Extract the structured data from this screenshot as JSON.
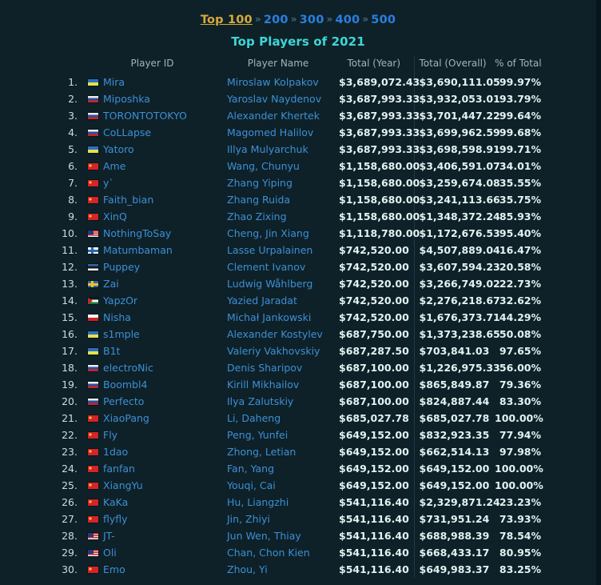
{
  "nav": {
    "items": [
      {
        "label": "Top 100",
        "current": true
      },
      {
        "label": "200",
        "current": false
      },
      {
        "label": "300",
        "current": false
      },
      {
        "label": "400",
        "current": false
      },
      {
        "label": "500",
        "current": false
      }
    ],
    "separator": "»"
  },
  "page_title": "Top Players of 2021",
  "colors": {
    "background": "#0e2128",
    "title": "#3fd6d6",
    "link": "#3d8fd6",
    "current_nav": "#d9a93a",
    "value_text": "#e3f2f3",
    "header_text": "#9fb5bb"
  },
  "table": {
    "headers": {
      "rank": "",
      "player_id": "Player ID",
      "player_name": "Player Name",
      "total_year": "Total (Year)",
      "total_overall": "Total (Overall)",
      "pct_of_total": "% of Total"
    },
    "rows": [
      {
        "rank": "1.",
        "flag": "ua",
        "player_id": "Mira",
        "player_name": "Miroslaw Kolpakov",
        "total_year": "$3,689,072.43",
        "total_overall": "$3,690,111.05",
        "pct": "99.97%"
      },
      {
        "rank": "2.",
        "flag": "ru",
        "player_id": "Miposhka",
        "player_name": "Yaroslav Naydenov",
        "total_year": "$3,687,993.33",
        "total_overall": "$3,932,053.01",
        "pct": "93.79%"
      },
      {
        "rank": "3.",
        "flag": "ru",
        "player_id": "TORONTOTOKYO",
        "player_name": "Alexander Khertek",
        "total_year": "$3,687,993.33",
        "total_overall": "$3,701,447.22",
        "pct": "99.64%"
      },
      {
        "rank": "4.",
        "flag": "ru",
        "player_id": "CoLLapse",
        "player_name": "Magomed Halilov",
        "total_year": "$3,687,993.33",
        "total_overall": "$3,699,962.59",
        "pct": "99.68%"
      },
      {
        "rank": "5.",
        "flag": "ua",
        "player_id": "Yatoro",
        "player_name": "Illya Mulyarchuk",
        "total_year": "$3,687,993.33",
        "total_overall": "$3,698,598.91",
        "pct": "99.71%"
      },
      {
        "rank": "6.",
        "flag": "cn",
        "player_id": "Ame",
        "player_name": "Wang, Chunyu",
        "total_year": "$1,158,680.00",
        "total_overall": "$3,406,591.07",
        "pct": "34.01%"
      },
      {
        "rank": "7.",
        "flag": "cn",
        "player_id": "y`",
        "player_name": "Zhang Yiping",
        "total_year": "$1,158,680.00",
        "total_overall": "$3,259,674.08",
        "pct": "35.55%"
      },
      {
        "rank": "8.",
        "flag": "cn",
        "player_id": "Faith_bian",
        "player_name": "Zhang Ruida",
        "total_year": "$1,158,680.00",
        "total_overall": "$3,241,113.66",
        "pct": "35.75%"
      },
      {
        "rank": "9.",
        "flag": "cn",
        "player_id": "XinQ",
        "player_name": "Zhao Zixing",
        "total_year": "$1,158,680.00",
        "total_overall": "$1,348,372.24",
        "pct": "85.93%"
      },
      {
        "rank": "10.",
        "flag": "my",
        "player_id": "NothingToSay",
        "player_name": "Cheng, Jin Xiang",
        "total_year": "$1,118,780.00",
        "total_overall": "$1,172,676.53",
        "pct": "95.40%"
      },
      {
        "rank": "11.",
        "flag": "fi",
        "player_id": "Matumbaman",
        "player_name": "Lasse Urpalainen",
        "total_year": "$742,520.00",
        "total_overall": "$4,507,889.04",
        "pct": "16.47%"
      },
      {
        "rank": "12.",
        "flag": "ee",
        "player_id": "Puppey",
        "player_name": "Clement Ivanov",
        "total_year": "$742,520.00",
        "total_overall": "$3,607,594.23",
        "pct": "20.58%"
      },
      {
        "rank": "13.",
        "flag": "se",
        "player_id": "Zai",
        "player_name": "Ludwig Wåhlberg",
        "total_year": "$742,520.00",
        "total_overall": "$3,266,749.02",
        "pct": "22.73%"
      },
      {
        "rank": "14.",
        "flag": "jo",
        "player_id": "YapzOr",
        "player_name": "Yazied Jaradat",
        "total_year": "$742,520.00",
        "total_overall": "$2,276,218.67",
        "pct": "32.62%"
      },
      {
        "rank": "15.",
        "flag": "pl",
        "player_id": "Nisha",
        "player_name": "Michał Jankowski",
        "total_year": "$742,520.00",
        "total_overall": "$1,676,373.71",
        "pct": "44.29%"
      },
      {
        "rank": "16.",
        "flag": "ua",
        "player_id": "s1mple",
        "player_name": "Alexander Kostylev",
        "total_year": "$687,750.00",
        "total_overall": "$1,373,238.65",
        "pct": "50.08%"
      },
      {
        "rank": "17.",
        "flag": "ua",
        "player_id": "B1t",
        "player_name": "Valeriy Vakhovskiy",
        "total_year": "$687,287.50",
        "total_overall": "$703,841.03",
        "pct": "97.65%"
      },
      {
        "rank": "18.",
        "flag": "ru",
        "player_id": "electroNic",
        "player_name": "Denis Sharipov",
        "total_year": "$687,100.00",
        "total_overall": "$1,226,975.33",
        "pct": "56.00%"
      },
      {
        "rank": "19.",
        "flag": "ru",
        "player_id": "Boombl4",
        "player_name": "Kirill Mikhailov",
        "total_year": "$687,100.00",
        "total_overall": "$865,849.87",
        "pct": "79.36%"
      },
      {
        "rank": "20.",
        "flag": "ru",
        "player_id": "Perfecto",
        "player_name": "Ilya Zalutskiy",
        "total_year": "$687,100.00",
        "total_overall": "$824,887.44",
        "pct": "83.30%"
      },
      {
        "rank": "21.",
        "flag": "cn",
        "player_id": "XiaoPang",
        "player_name": "Li, Daheng",
        "total_year": "$685,027.78",
        "total_overall": "$685,027.78",
        "pct": "100.00%"
      },
      {
        "rank": "22.",
        "flag": "cn",
        "player_id": "Fly",
        "player_name": "Peng, Yunfei",
        "total_year": "$649,152.00",
        "total_overall": "$832,923.35",
        "pct": "77.94%"
      },
      {
        "rank": "23.",
        "flag": "cn",
        "player_id": "1dao",
        "player_name": "Zhong, Letian",
        "total_year": "$649,152.00",
        "total_overall": "$662,514.13",
        "pct": "97.98%"
      },
      {
        "rank": "24.",
        "flag": "cn",
        "player_id": "fanfan",
        "player_name": "Fan, Yang",
        "total_year": "$649,152.00",
        "total_overall": "$649,152.00",
        "pct": "100.00%"
      },
      {
        "rank": "25.",
        "flag": "cn",
        "player_id": "XiangYu",
        "player_name": "Youqi, Cai",
        "total_year": "$649,152.00",
        "total_overall": "$649,152.00",
        "pct": "100.00%"
      },
      {
        "rank": "26.",
        "flag": "cn",
        "player_id": "KaKa",
        "player_name": "Hu, Liangzhi",
        "total_year": "$541,116.40",
        "total_overall": "$2,329,871.24",
        "pct": "23.23%"
      },
      {
        "rank": "27.",
        "flag": "cn",
        "player_id": "flyfly",
        "player_name": "Jin, Zhiyi",
        "total_year": "$541,116.40",
        "total_overall": "$731,951.24",
        "pct": "73.93%"
      },
      {
        "rank": "28.",
        "flag": "my",
        "player_id": "JT-",
        "player_name": "Jun Wen, Thiay",
        "total_year": "$541,116.40",
        "total_overall": "$688,988.39",
        "pct": "78.54%"
      },
      {
        "rank": "29.",
        "flag": "my",
        "player_id": "Oli",
        "player_name": "Chan, Chon Kien",
        "total_year": "$541,116.40",
        "total_overall": "$668,433.17",
        "pct": "80.95%"
      },
      {
        "rank": "30.",
        "flag": "cn",
        "player_id": "Emo",
        "player_name": "Zhou, Yi",
        "total_year": "$541,116.40",
        "total_overall": "$649,983.37",
        "pct": "83.25%"
      }
    ]
  }
}
